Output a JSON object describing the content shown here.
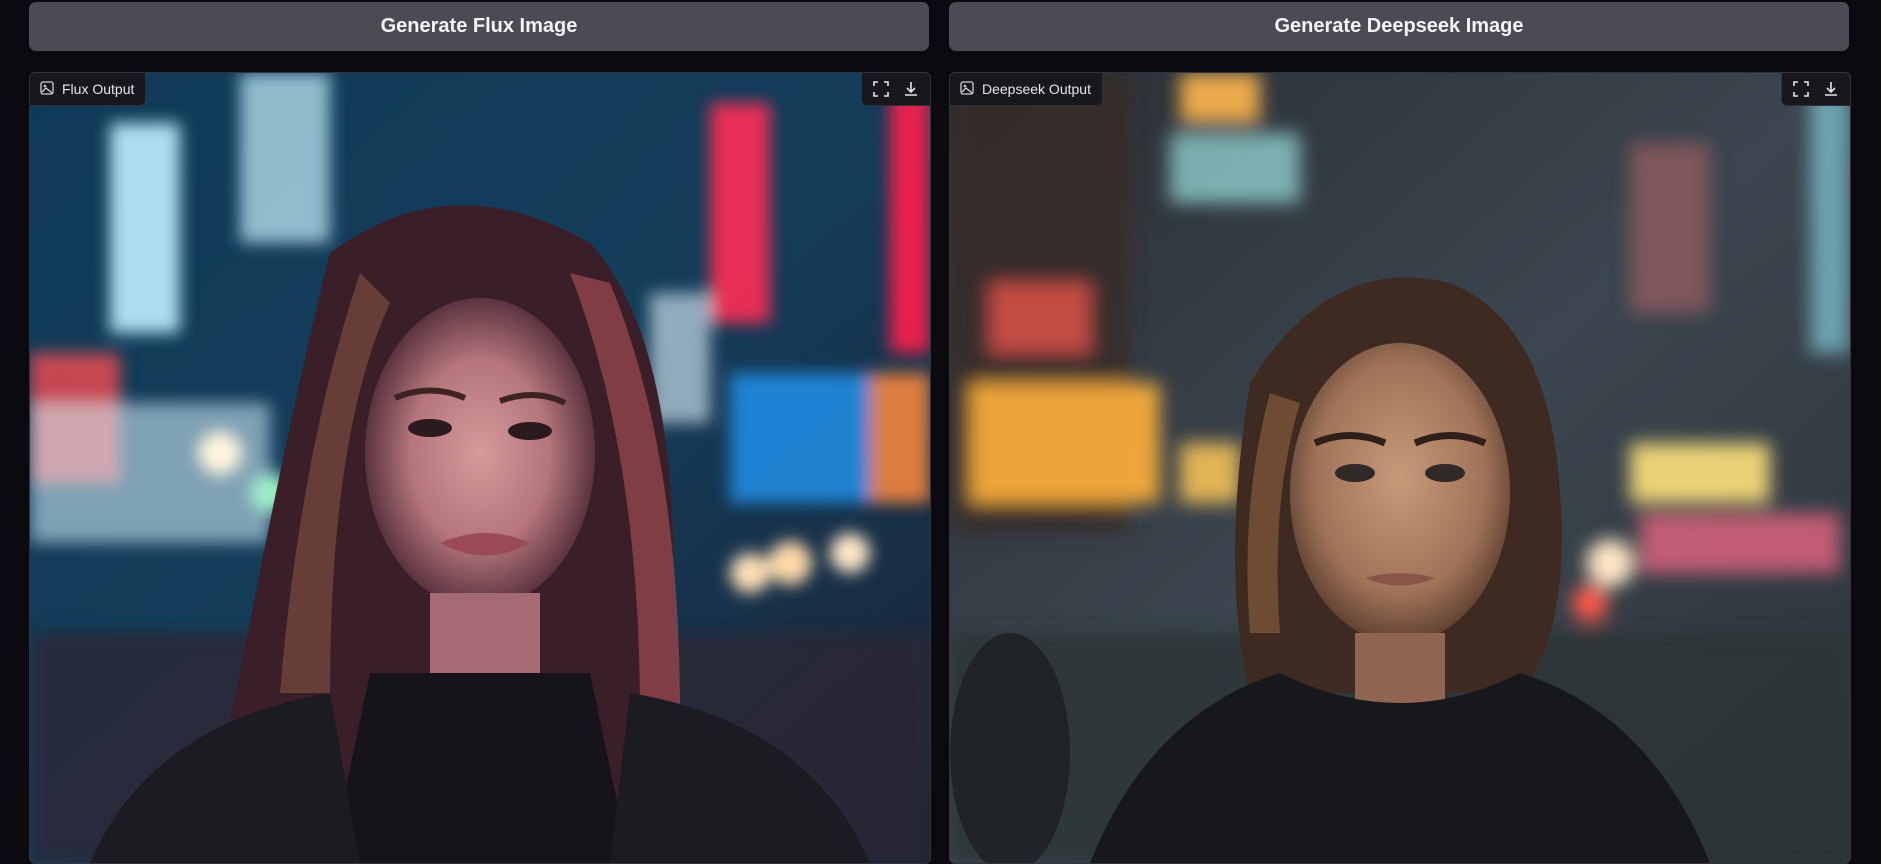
{
  "buttons": {
    "flux_label": "Generate Flux Image",
    "deepseek_label": "Generate Deepseek Image"
  },
  "outputs": {
    "flux_label": "Flux Output",
    "deepseek_label": "Deepseek Output",
    "icons": [
      "image-icon",
      "fullscreen-icon",
      "download-icon"
    ]
  },
  "colors": {
    "background": "#0b0b0f",
    "button_bg": "#4b4b55",
    "label_bg": "#17171c"
  }
}
